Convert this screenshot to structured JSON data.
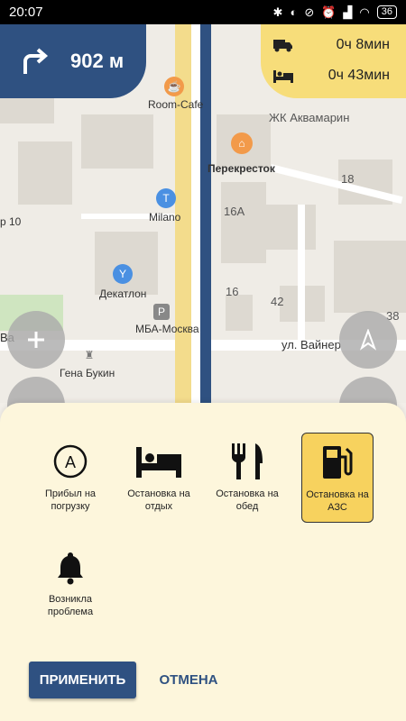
{
  "status": {
    "time": "20:07",
    "battery": "36"
  },
  "nav": {
    "distance": "902 м",
    "turn_icon": "turn-right-arrow-icon"
  },
  "eta": {
    "drive_time": "0ч 8мин",
    "rest_time": "0ч 43мин"
  },
  "map": {
    "labels": {
      "room_cafe": "Room-Cafe",
      "akvamarin": "ЖК Аквамарин",
      "perekrestok": "Перекресток",
      "n18": "18",
      "p10": "р 10",
      "n16a": "16А",
      "milano": "Milano",
      "dekatlon": "Декатлон",
      "n16": "16",
      "n42": "42",
      "mba": "МБА-Москва",
      "n38": "38",
      "street": "ул. Вайнер",
      "gena": "Гена Букин",
      "va": "Ва"
    }
  },
  "sheet": {
    "options": [
      {
        "label": "Прибыл на погрузку",
        "icon": "circle-a-icon"
      },
      {
        "label": "Остановка на отдых",
        "icon": "bed-icon"
      },
      {
        "label": "Остановка на обед",
        "icon": "fork-knife-icon"
      },
      {
        "label": "Остановка на АЗС",
        "icon": "fuel-pump-icon",
        "selected": true
      },
      {
        "label": "Возникла проблема",
        "icon": "bell-icon"
      }
    ],
    "apply_label": "ПРИМЕНИТЬ",
    "cancel_label": "ОТМЕНА"
  },
  "colors": {
    "primary": "#2f5181",
    "eta_bg": "#f7dd7a",
    "selected_bg": "#f7d25e",
    "sheet_bg": "#fdf6dc"
  }
}
